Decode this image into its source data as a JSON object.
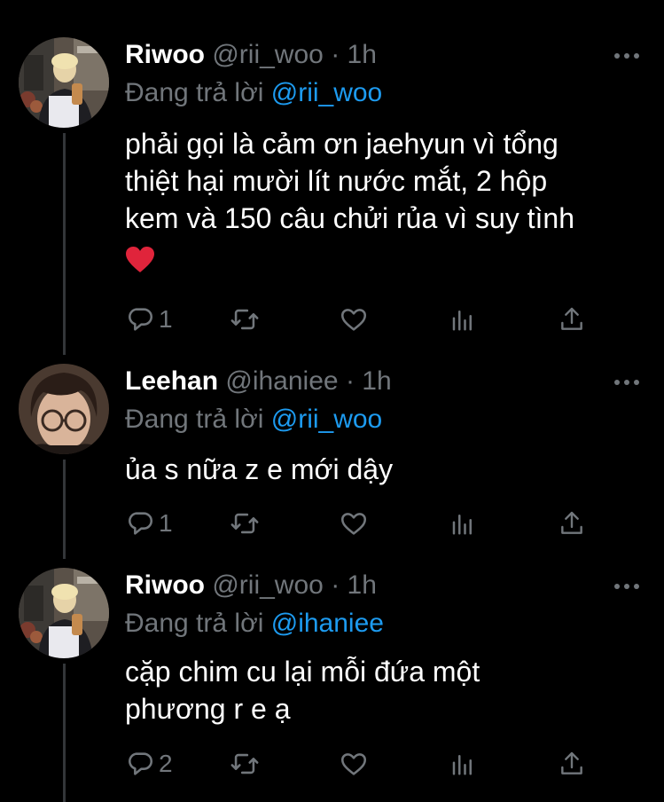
{
  "colors": {
    "background": "#000000",
    "text": "#ffffff",
    "secondary": "#71767b",
    "accent": "#1d9bf0",
    "thread_line": "#333639",
    "heart_emoji": "#e0243b"
  },
  "tweets": [
    {
      "name": "Riwoo",
      "handle": "@rii_woo",
      "separator": "·",
      "time": "1h",
      "reply_prefix": "Đang trả lời",
      "reply_to": "@rii_woo",
      "text_lines": [
        "phải gọi là cảm ơn jaehyun vì tổng",
        "thiệt hại mười lít nước mắt, 2 hộp",
        "kem và 150 câu chửi rủa vì suy tình"
      ],
      "emoji": "heart",
      "reply_count": "1",
      "avatar_icon": "user-avatar-riwoo"
    },
    {
      "name": "Leehan",
      "handle": "@ihaniee",
      "separator": "·",
      "time": "1h",
      "reply_prefix": "Đang trả lời",
      "reply_to": "@rii_woo",
      "text_lines": [
        "ủa s nữa z e mới dậy"
      ],
      "reply_count": "1",
      "avatar_icon": "user-avatar-leehan"
    },
    {
      "name": "Riwoo",
      "handle": "@rii_woo",
      "separator": "·",
      "time": "1h",
      "reply_prefix": "Đang trả lời",
      "reply_to": "@ihaniee",
      "text_lines": [
        "cặp chim cu lại mỗi đứa một",
        "phương r e ạ"
      ],
      "reply_count": "2",
      "avatar_icon": "user-avatar-riwoo"
    }
  ],
  "action_icons": [
    "reply-icon",
    "retweet-icon",
    "like-icon",
    "analytics-icon",
    "share-icon"
  ]
}
